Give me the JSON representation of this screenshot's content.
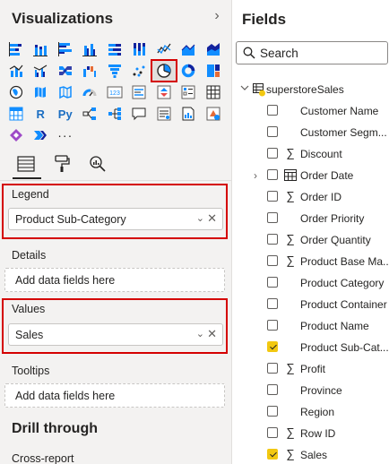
{
  "visualizations": {
    "title": "Visualizations",
    "subtabs": [
      "fields-tab",
      "format-tab",
      "analytics-tab"
    ],
    "selected_icon": "pie-chart-icon",
    "wells": {
      "legend_label": "Legend",
      "legend_field": "Product Sub-Category",
      "details_label": "Details",
      "details_placeholder": "Add data fields here",
      "values_label": "Values",
      "values_field": "Sales",
      "tooltips_label": "Tooltips",
      "tooltips_placeholder": "Add data fields here"
    },
    "drill_title": "Drill through",
    "cross_report_label": "Cross-report",
    "highlight_color": "#d40000"
  },
  "fields": {
    "title": "Fields",
    "search_placeholder": "Search",
    "table_name": "superstoreSales",
    "items": [
      {
        "name": "Customer Name",
        "type": "",
        "checked": false,
        "expandable": false
      },
      {
        "name": "Customer Segm...",
        "type": "",
        "checked": false,
        "expandable": false
      },
      {
        "name": "Discount",
        "type": "sigma",
        "checked": false,
        "expandable": false
      },
      {
        "name": "Order Date",
        "type": "calendar",
        "checked": false,
        "expandable": true
      },
      {
        "name": "Order ID",
        "type": "sigma",
        "checked": false,
        "expandable": false
      },
      {
        "name": "Order Priority",
        "type": "",
        "checked": false,
        "expandable": false
      },
      {
        "name": "Order Quantity",
        "type": "sigma",
        "checked": false,
        "expandable": false
      },
      {
        "name": "Product Base Ma...",
        "type": "sigma",
        "checked": false,
        "expandable": false
      },
      {
        "name": "Product Category",
        "type": "",
        "checked": false,
        "expandable": false
      },
      {
        "name": "Product Container",
        "type": "",
        "checked": false,
        "expandable": false
      },
      {
        "name": "Product Name",
        "type": "",
        "checked": false,
        "expandable": false
      },
      {
        "name": "Product Sub-Cat...",
        "type": "",
        "checked": true,
        "expandable": false
      },
      {
        "name": "Profit",
        "type": "sigma",
        "checked": false,
        "expandable": false
      },
      {
        "name": "Province",
        "type": "",
        "checked": false,
        "expandable": false
      },
      {
        "name": "Region",
        "type": "",
        "checked": false,
        "expandable": false
      },
      {
        "name": "Row ID",
        "type": "sigma",
        "checked": false,
        "expandable": false
      },
      {
        "name": "Sales",
        "type": "sigma",
        "checked": true,
        "expandable": false
      }
    ],
    "check_color": "#f2c811"
  }
}
